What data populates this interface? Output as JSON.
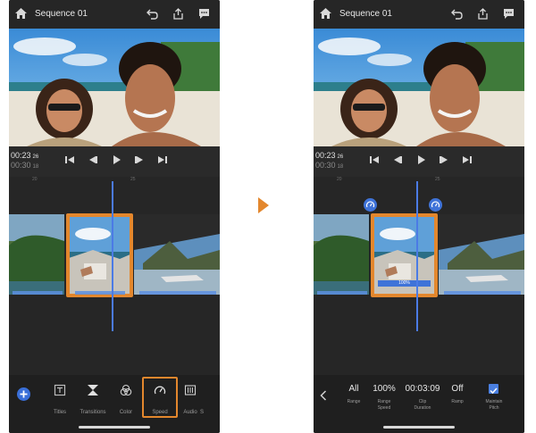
{
  "header": {
    "title": "Sequence 01"
  },
  "playback": {
    "current_time": "00:23",
    "current_frames": "26",
    "total_time": "00:30",
    "total_frames": "18"
  },
  "ruler": {
    "left_mark": "20",
    "right_mark": "25"
  },
  "speed_badge": "100%",
  "toolbar_left": {
    "tools": [
      "Titles",
      "Transitions",
      "Color",
      "Speed",
      "Audio",
      "S"
    ]
  },
  "toolbar_right": {
    "range": {
      "value": "All",
      "label": "Range"
    },
    "range_speed": {
      "value": "100%",
      "label_line1": "Range",
      "label_line2": "Speed"
    },
    "clip_duration": {
      "value": "00:03:09",
      "label_line1": "Clip",
      "label_line2": "Duration"
    },
    "ramp": {
      "value": "Off",
      "label": "Ramp"
    },
    "maintain_pitch": {
      "checked": true,
      "label_line1": "Maintain",
      "label_line2": "Pitch"
    }
  },
  "icons": {
    "home": "home-icon",
    "undo": "undo-icon",
    "share": "share-icon",
    "comment": "comment-icon",
    "add": "add-icon",
    "back": "chevron-left-icon",
    "arrow": "arrow-right-icon"
  },
  "colors": {
    "accent_orange": "#e3872d",
    "accent_blue": "#3f73d8",
    "panel_dark": "#2a2a2a",
    "toolbar_dark": "#1f1f1f"
  }
}
